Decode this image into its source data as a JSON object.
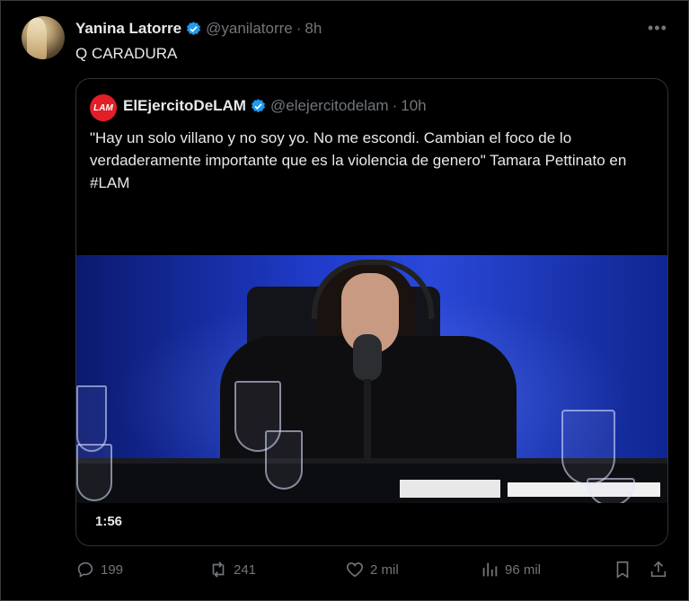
{
  "author": {
    "name": "Yanina Latorre",
    "handle": "@yanilatorre",
    "separator": "·",
    "time": "8h",
    "text": "Q CARADURA"
  },
  "quoted": {
    "avatar_text": "LAM",
    "name": "ElEjercitoDeLAM",
    "handle": "@elejercitodelam",
    "separator": "·",
    "time": "10h",
    "text": "\"Hay un solo villano y no soy yo. No me escondi. Cambian el foco de lo verdaderamente importante que es la violencia de genero\" Tamara Pettinato en #LAM",
    "video_duration": "1:56"
  },
  "actions": {
    "replies": "199",
    "reposts": "241",
    "likes": "2 mil",
    "views": "96 mil"
  },
  "colors": {
    "background": "#000000",
    "text": "#e7e9ea",
    "muted": "#71767b",
    "verified": "#1d9bf0",
    "lam_badge": "#e21f26"
  },
  "icons": [
    "verified-icon",
    "more-icon",
    "reply-icon",
    "repost-icon",
    "like-icon",
    "views-icon",
    "bookmark-icon",
    "share-icon"
  ]
}
